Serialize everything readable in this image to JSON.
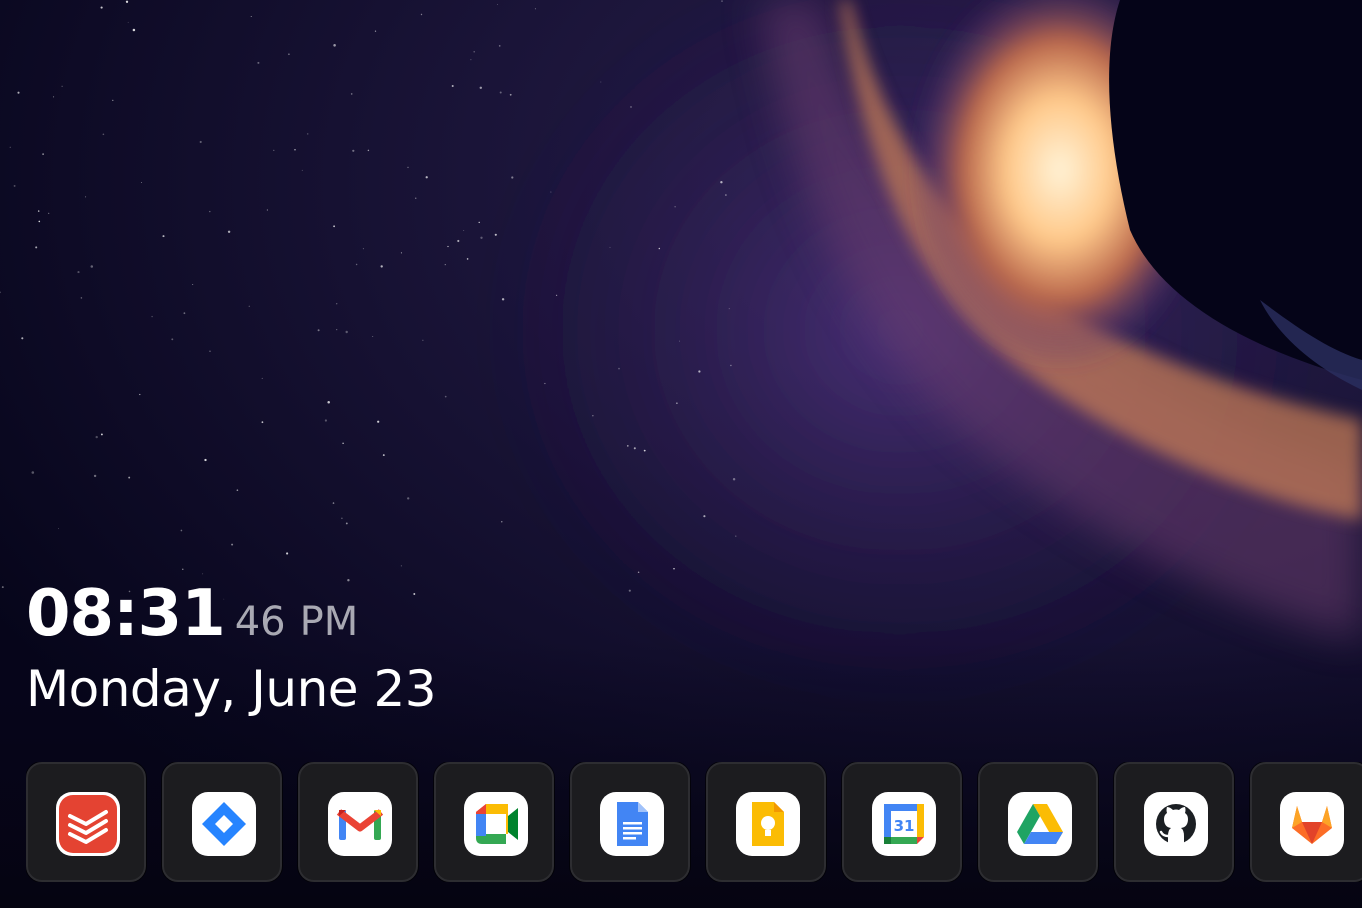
{
  "clock": {
    "hours_minutes": "08:31",
    "seconds": "46",
    "ampm": "PM",
    "date": "Monday, June 23"
  },
  "dock": {
    "apps": [
      {
        "name": "Todoist",
        "icon": "todoist-icon",
        "color": "#e44332"
      },
      {
        "name": "Jira",
        "icon": "jira-icon",
        "color": "#2684ff"
      },
      {
        "name": "Gmail",
        "icon": "gmail-icon",
        "color": "#ea4335"
      },
      {
        "name": "Google Meet",
        "icon": "google-meet-icon",
        "color": "#00832d"
      },
      {
        "name": "Google Docs",
        "icon": "google-docs-icon",
        "color": "#4285f4"
      },
      {
        "name": "Google Keep",
        "icon": "google-keep-icon",
        "color": "#fbbc04"
      },
      {
        "name": "Google Calendar",
        "icon": "google-calendar-icon",
        "color": "#4285f4",
        "day": "31"
      },
      {
        "name": "Google Drive",
        "icon": "google-drive-icon",
        "color": "#1fa463"
      },
      {
        "name": "GitHub",
        "icon": "github-icon",
        "color": "#1b1f23"
      },
      {
        "name": "GitLab",
        "icon": "gitlab-icon",
        "color": "#fc6d26"
      }
    ]
  },
  "colors": {
    "background": "#07061a",
    "nebula_glow": "#ffd9a0",
    "nebula_purple": "#4a2f7a",
    "tile_background": "#1c1c1f",
    "time_secondary": "#a9a9b3"
  }
}
